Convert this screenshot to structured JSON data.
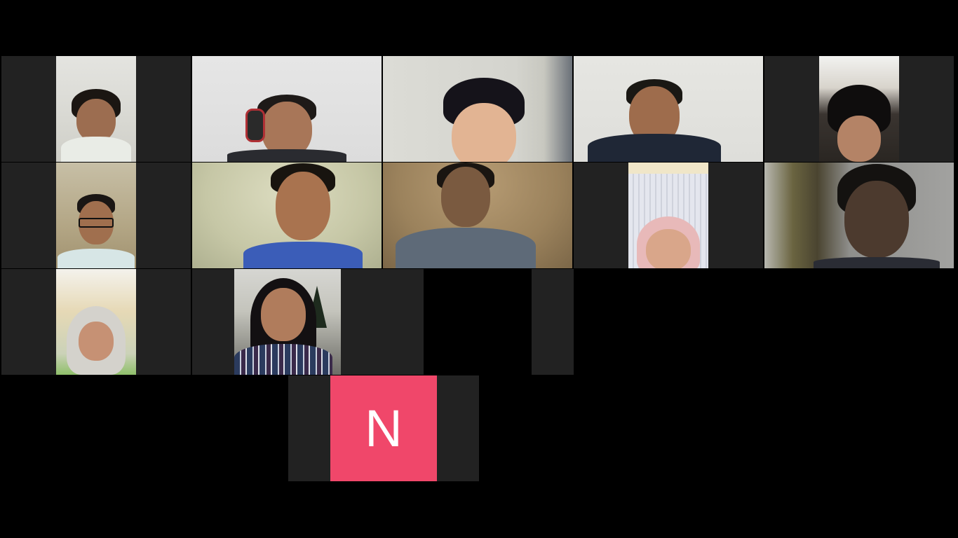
{
  "meeting": {
    "view": "gallery",
    "accent_avatar_color": "#F0476A",
    "participants": [
      {
        "id": "p1",
        "video": "on"
      },
      {
        "id": "p2",
        "video": "on",
        "accessory": "headset"
      },
      {
        "id": "p3",
        "video": "on"
      },
      {
        "id": "p4",
        "video": "on",
        "accessory": "headset"
      },
      {
        "id": "p5",
        "video": "on"
      },
      {
        "id": "p6",
        "video": "on",
        "accessory": "glasses"
      },
      {
        "id": "p7",
        "video": "on"
      },
      {
        "id": "p8",
        "video": "on",
        "accessory": "earphones"
      },
      {
        "id": "p9",
        "video": "on",
        "accessory": "hijab"
      },
      {
        "id": "p10",
        "video": "on"
      },
      {
        "id": "p11",
        "video": "on",
        "accessory": "hijab"
      },
      {
        "id": "p12",
        "video": "on"
      },
      {
        "id": "p13",
        "video": "off-blank"
      },
      {
        "id": "p14",
        "video": "off",
        "avatar_initial": "N"
      }
    ]
  }
}
